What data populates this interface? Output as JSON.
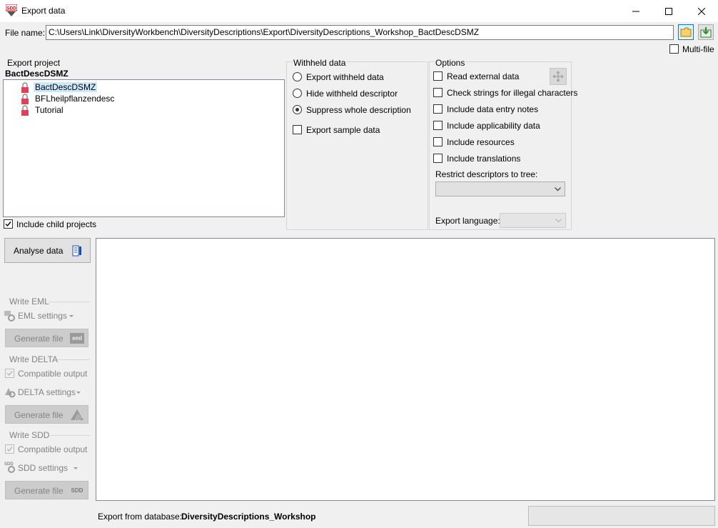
{
  "window": {
    "title": "Export data",
    "app_icon_text": "SDD"
  },
  "file": {
    "label": "File name:",
    "path": "C:\\Users\\Link\\DiversityWorkbench\\DiversityDescriptions\\Export\\DiversityDescriptions_Workshop_BactDescDSMZ",
    "multi_file_label": "Multi-file",
    "multi_file_checked": false
  },
  "export_project": {
    "title": "Export project",
    "selected": "BactDescDSMZ",
    "items": [
      "BactDescDSMZ",
      "BFLheilpflanzendesc",
      "Tutorial"
    ],
    "include_child_label": "Include child projects",
    "include_child_checked": true
  },
  "withheld": {
    "title": "Withheld data",
    "options": [
      "Export withheld data",
      "Hide withheld descriptor",
      "Suppress whole description"
    ],
    "selected_index": 2,
    "export_sample_label": "Export sample data"
  },
  "options": {
    "title": "Options",
    "checkboxes": [
      "Read external data",
      "Check strings for illegal characters",
      "Include data entry notes",
      "Include applicability data",
      "Include resources",
      "Include translations"
    ],
    "restrict_label": "Restrict descriptors to tree:",
    "restrict_value": "",
    "export_language_label": "Export language:",
    "export_language_value": ""
  },
  "left_panel": {
    "analyse_label": "Analyse data",
    "eml": {
      "group_title": "Write EML",
      "settings_label": "EML settings",
      "generate_label": "Generate file",
      "generate_icon_text": "eml"
    },
    "delta": {
      "group_title": "Write DELTA",
      "compatible_label": "Compatible output",
      "settings_label": "DELTA settings",
      "generate_label": "Generate file"
    },
    "sdd": {
      "group_title": "Write SDD",
      "compatible_label": "Compatible output",
      "settings_label": "SDD settings",
      "generate_label": "Generate file",
      "generate_icon_text": "SDD"
    }
  },
  "footer": {
    "database_label": "Export from database:",
    "database_name": "DiversityDescriptions_Workshop"
  },
  "colors": {
    "selection": "#cce8ff",
    "accent": "#0078d7",
    "lock_red": "#e0405a"
  }
}
